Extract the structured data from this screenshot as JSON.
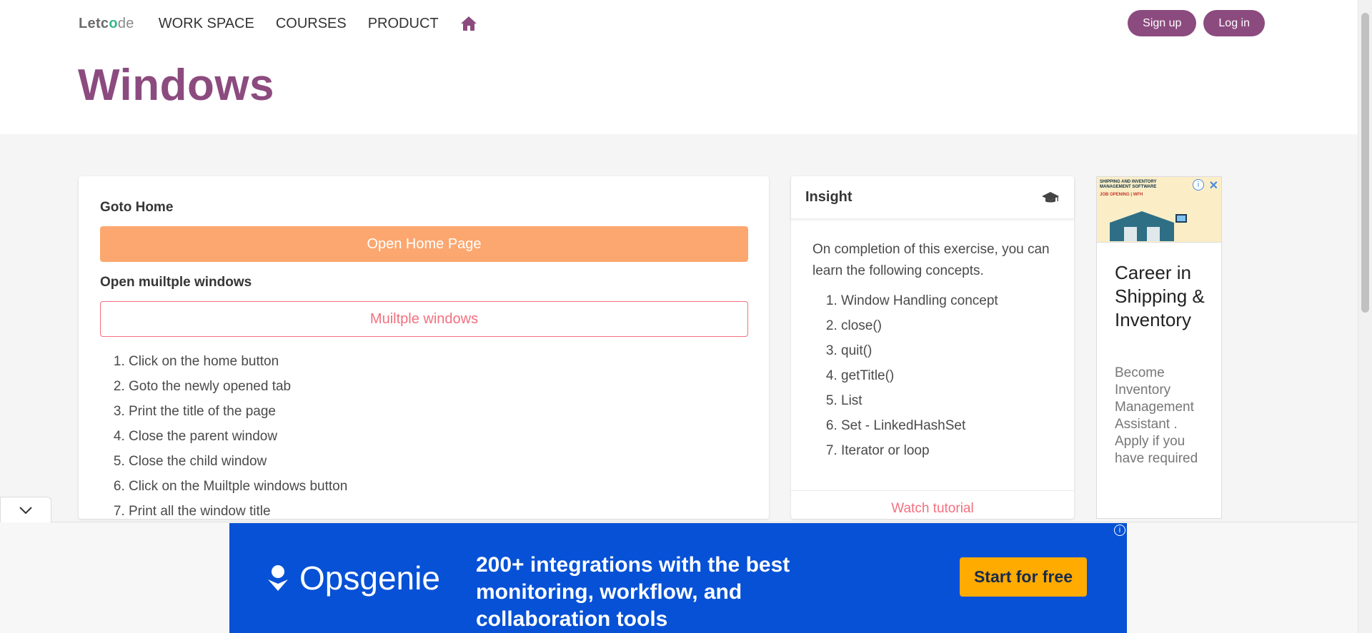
{
  "nav": {
    "logo_prefix": "Letc",
    "logo_o": "o",
    "logo_suffix": "de",
    "links": [
      "WORK SPACE",
      "COURSES",
      "PRODUCT"
    ],
    "home_icon": "home-icon",
    "signup": "Sign up",
    "login": "Log in"
  },
  "page": {
    "title": "Windows"
  },
  "main": {
    "goto_home_label": "Goto Home",
    "open_home_button": "Open Home Page",
    "multi_label": "Open muiltple windows",
    "multi_button": "Muiltple windows",
    "steps": [
      "Click on the home button",
      "Goto the newly opened tab",
      "Print the title of the page",
      "Close the parent window",
      "Close the child window",
      "Click on the Muiltple windows button",
      "Print all the window title"
    ]
  },
  "insight": {
    "title": "Insight",
    "icon": "graduation-cap-icon",
    "intro": "On completion of this exercise, you can learn the following concepts.",
    "concepts": [
      "Window Handling concept",
      "close()",
      "quit()",
      "getTitle()",
      "List",
      "Set - LinkedHashSet",
      "Iterator or loop"
    ],
    "watch": "Watch tutorial"
  },
  "side_ad": {
    "image_text_1": "SHIPPING AND INVENTORY MANAGEMENT SOFTWARE",
    "image_text_2": "JOB OPENING | WFH",
    "heading": "Career in Shipping & Inventory",
    "text": "Become Inventory Management Assistant . Apply if you have required"
  },
  "banner": {
    "brand": "Opsgenie",
    "message": "200+ integrations with the best monitoring, workflow, and collaboration tools",
    "cta": "Start for free"
  },
  "colors": {
    "brand": "#8c4b7f",
    "orange": "#fca76f",
    "pink": "#f2707f",
    "banner_blue": "#0651d6",
    "cta_yellow": "#ffab00"
  }
}
